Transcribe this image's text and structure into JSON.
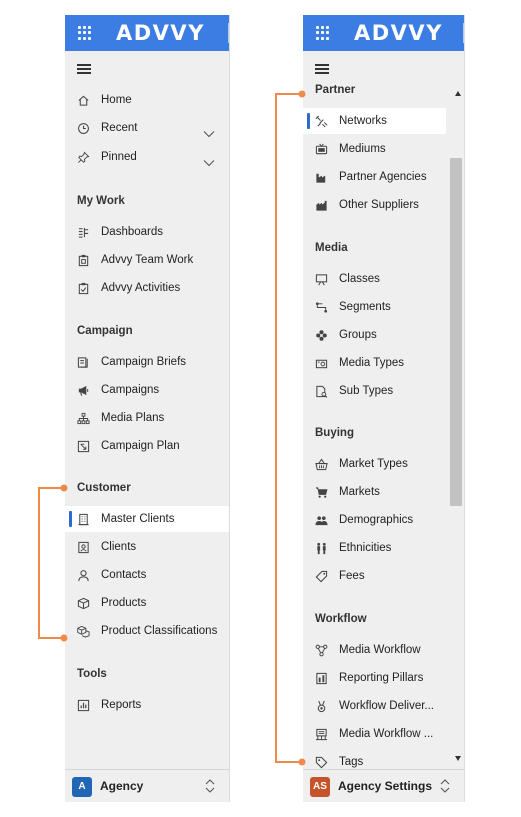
{
  "app": {
    "logo": "ADVVY"
  },
  "left": {
    "items": [
      {
        "label": "Home",
        "icon": "home-icon"
      },
      {
        "label": "Recent",
        "icon": "clock-icon"
      },
      {
        "label": "Pinned",
        "icon": "pin-icon"
      },
      {
        "label": "Dashboards",
        "icon": "dashboard-icon"
      },
      {
        "label": "Advvy Team Work",
        "icon": "clipboard-icon"
      },
      {
        "label": "Advvy Activities",
        "icon": "clipboard-check-icon"
      },
      {
        "label": "Campaign Briefs",
        "icon": "brief-icon"
      },
      {
        "label": "Campaigns",
        "icon": "megaphone-icon"
      },
      {
        "label": "Media Plans",
        "icon": "hierarchy-icon"
      },
      {
        "label": "Campaign Plan",
        "icon": "plan-icon"
      },
      {
        "label": "Master Clients",
        "icon": "building-icon"
      },
      {
        "label": "Clients",
        "icon": "contact-card-icon"
      },
      {
        "label": "Contacts",
        "icon": "person-icon"
      },
      {
        "label": "Products",
        "icon": "box-icon"
      },
      {
        "label": "Product Classifications",
        "icon": "boxes-icon"
      },
      {
        "label": "Reports",
        "icon": "report-icon"
      }
    ],
    "sections": {
      "my_work": "My Work",
      "campaign": "Campaign",
      "customer": "Customer",
      "tools": "Tools"
    },
    "footer": {
      "avatar": "A",
      "label": "Agency",
      "avatar_color": "#2166b5"
    }
  },
  "right": {
    "sections": {
      "partner": "Partner",
      "media": "Media",
      "buying": "Buying",
      "workflow": "Workflow"
    },
    "items": [
      {
        "label": "Networks",
        "icon": "satellite-icon"
      },
      {
        "label": "Mediums",
        "icon": "tv-icon"
      },
      {
        "label": "Partner Agencies",
        "icon": "factory-icon"
      },
      {
        "label": "Other Suppliers",
        "icon": "factory-icon"
      },
      {
        "label": "Classes",
        "icon": "easel-icon"
      },
      {
        "label": "Segments",
        "icon": "segments-icon"
      },
      {
        "label": "Groups",
        "icon": "flower-icon"
      },
      {
        "label": "Media Types",
        "icon": "camera-icon"
      },
      {
        "label": "Sub Types",
        "icon": "subtypes-icon"
      },
      {
        "label": "Market Types",
        "icon": "basket-icon"
      },
      {
        "label": "Markets",
        "icon": "cart-icon"
      },
      {
        "label": "Demographics",
        "icon": "people-icon"
      },
      {
        "label": "Ethnicities",
        "icon": "pair-icon"
      },
      {
        "label": "Fees",
        "icon": "tag-icon"
      },
      {
        "label": "Media Workflow",
        "icon": "workflow-icon"
      },
      {
        "label": "Reporting Pillars",
        "icon": "pillars-icon"
      },
      {
        "label": "Workflow Deliver...",
        "icon": "medal-icon"
      },
      {
        "label": "Media Workflow ...",
        "icon": "workflow-grid-icon"
      },
      {
        "label": "Tags",
        "icon": "tag-icon"
      }
    ],
    "footer": {
      "avatar": "AS",
      "label": "Agency Settings",
      "avatar_color": "#c6542a"
    }
  },
  "colors": {
    "header": "#3b7de3",
    "selected_bar": "#2a6ccd",
    "annotation": "#f08a4b"
  }
}
